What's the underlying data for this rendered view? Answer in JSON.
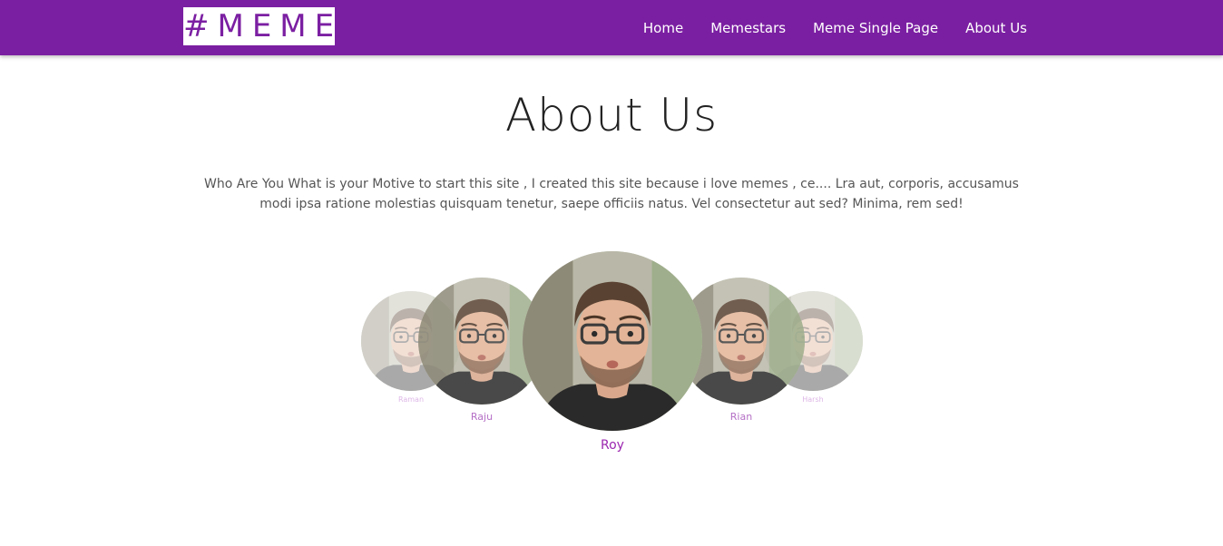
{
  "brand": {
    "logo_text": "#MEMES",
    "color": "#7b1fa2"
  },
  "nav": {
    "items": [
      {
        "label": "Home"
      },
      {
        "label": "Memestars"
      },
      {
        "label": "Meme Single Page"
      },
      {
        "label": "About Us"
      }
    ]
  },
  "main": {
    "title": "About Us",
    "intro": "Who Are You What is your Motive to start this site , I created this site because i love memes , ce.... Lra aut, corporis, accusamus modi ipsa ratione molestias quisquam tenetur, saepe officiis natus. Vel consectetur aut sed? Minima, rem sed!"
  },
  "team": {
    "members": [
      {
        "name": "Raman"
      },
      {
        "name": "Raju"
      },
      {
        "name": "Roy"
      },
      {
        "name": "Rian"
      },
      {
        "name": "Harsh"
      }
    ],
    "name_color": "#9c27b0"
  }
}
